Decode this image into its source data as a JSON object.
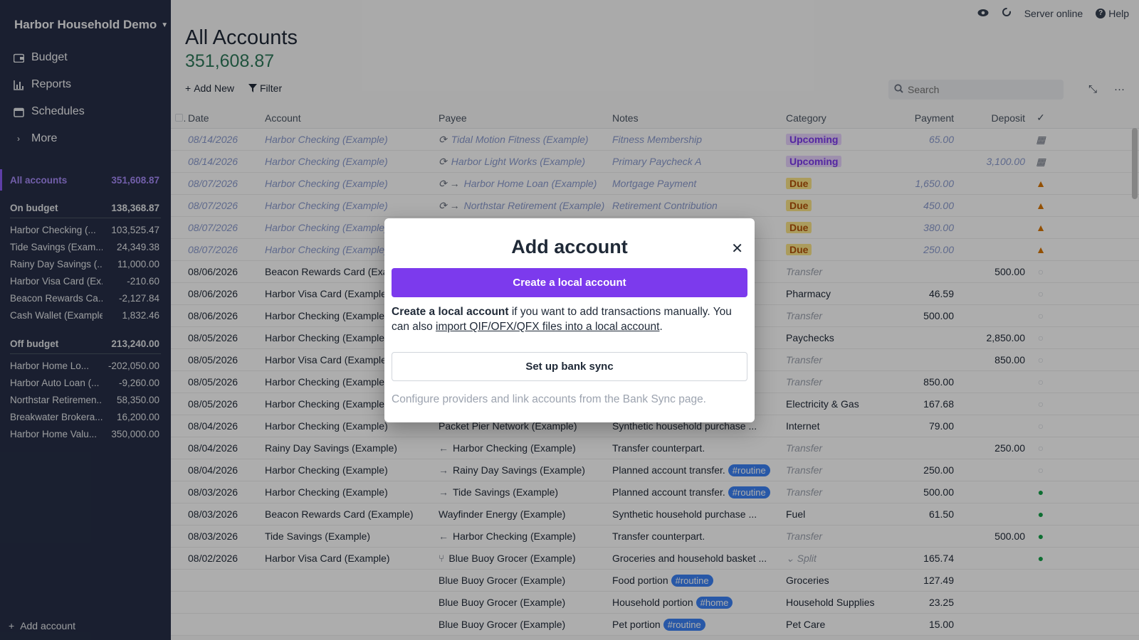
{
  "sidebar": {
    "budget_name": "Harbor Household Demo",
    "nav": [
      {
        "label": "Budget",
        "icon": "wallet-icon"
      },
      {
        "label": "Reports",
        "icon": "chart-icon"
      },
      {
        "label": "Schedules",
        "icon": "calendar-icon"
      },
      {
        "label": "More",
        "icon": "chevron-right-icon"
      }
    ],
    "all_accounts": {
      "label": "All accounts",
      "value": "351,608.87"
    },
    "on_budget": {
      "label": "On budget",
      "value": "138,368.87"
    },
    "on_budget_accounts": [
      {
        "name": "Harbor Checking (...",
        "value": "103,525.47"
      },
      {
        "name": "Tide Savings (Exam...",
        "value": "24,349.38"
      },
      {
        "name": "Rainy Day Savings (...",
        "value": "11,000.00"
      },
      {
        "name": "Harbor Visa Card (Ex...",
        "value": "-210.60"
      },
      {
        "name": "Beacon Rewards Ca...",
        "value": "-2,127.84"
      },
      {
        "name": "Cash Wallet (Example)",
        "value": "1,832.46"
      }
    ],
    "off_budget": {
      "label": "Off budget",
      "value": "213,240.00"
    },
    "off_budget_accounts": [
      {
        "name": "Harbor Home Lo...",
        "value": "-202,050.00"
      },
      {
        "name": "Harbor Auto Loan (...",
        "value": "-9,260.00"
      },
      {
        "name": "Northstar Retiremen...",
        "value": "58,350.00"
      },
      {
        "name": "Breakwater Brokera...",
        "value": "16,200.00"
      },
      {
        "name": "Harbor Home Valu...",
        "value": "350,000.00"
      }
    ],
    "add_account": "Add account"
  },
  "topbar": {
    "server_status": "Server online",
    "help": "Help"
  },
  "main": {
    "title": "All Accounts",
    "balance": "351,608.87",
    "add_new": "Add New",
    "filter": "Filter",
    "search_placeholder": "Search"
  },
  "table": {
    "headers": {
      "date": "Date",
      "account": "Account",
      "payee": "Payee",
      "notes": "Notes",
      "category": "Category",
      "payment": "Payment",
      "deposit": "Deposit"
    },
    "rows": [
      {
        "date": "08/14/2026",
        "account": "Harbor Checking (Example)",
        "payee": "Tidal Motion Fitness (Example)",
        "payee_prefix": "⟳",
        "notes": "Fitness Membership",
        "tag": "",
        "category": "Upcoming",
        "cat_style": "upcoming",
        "payment": "65.00",
        "deposit": "",
        "status": "calendar",
        "future": true
      },
      {
        "date": "08/14/2026",
        "account": "Harbor Checking (Example)",
        "payee": "Harbor Light Works (Example)",
        "payee_prefix": "⟳",
        "notes": "Primary Paycheck A",
        "tag": "",
        "category": "Upcoming",
        "cat_style": "upcoming",
        "payment": "",
        "deposit": "3,100.00",
        "status": "calendar",
        "future": true
      },
      {
        "date": "08/07/2026",
        "account": "Harbor Checking (Example)",
        "payee": "Harbor Home Loan (Example)",
        "payee_prefix": "⟳ →",
        "notes": "Mortgage Payment",
        "tag": "",
        "category": "Due",
        "cat_style": "due",
        "payment": "1,650.00",
        "deposit": "",
        "status": "warning",
        "future": true
      },
      {
        "date": "08/07/2026",
        "account": "Harbor Checking (Example)",
        "payee": "Northstar Retirement (Example)",
        "payee_prefix": "⟳ →",
        "notes": "Retirement Contribution",
        "tag": "",
        "category": "Due",
        "cat_style": "due",
        "payment": "450.00",
        "deposit": "",
        "status": "warning",
        "future": true
      },
      {
        "date": "08/07/2026",
        "account": "Harbor Checking (Example)",
        "payee": "",
        "payee_prefix": "",
        "notes": "",
        "tag": "",
        "category": "Due",
        "cat_style": "due",
        "payment": "380.00",
        "deposit": "",
        "status": "warning",
        "future": true
      },
      {
        "date": "08/07/2026",
        "account": "Harbor Checking (Example)",
        "payee": "",
        "payee_prefix": "",
        "notes": "",
        "tag": "",
        "category": "Due",
        "cat_style": "due",
        "payment": "250.00",
        "deposit": "",
        "status": "warning",
        "future": true
      },
      {
        "date": "08/06/2026",
        "account": "Beacon Rewards Card (Example)",
        "payee": "",
        "payee_prefix": "",
        "notes": "",
        "tag": "",
        "category": "Transfer",
        "cat_style": "transfer",
        "payment": "",
        "deposit": "500.00",
        "status": "empty",
        "future": false
      },
      {
        "date": "08/06/2026",
        "account": "Harbor Visa Card (Example)",
        "payee": "",
        "payee_prefix": "",
        "notes": "",
        "tag": "",
        "category": "Pharmacy",
        "cat_style": "",
        "payment": "46.59",
        "deposit": "",
        "status": "empty",
        "future": false
      },
      {
        "date": "08/06/2026",
        "account": "Harbor Checking (Example)",
        "payee": "",
        "payee_prefix": "",
        "notes": "",
        "tag": "",
        "category": "Transfer",
        "cat_style": "transfer",
        "payment": "500.00",
        "deposit": "",
        "status": "empty",
        "future": false
      },
      {
        "date": "08/05/2026",
        "account": "Harbor Checking (Example)",
        "payee": "",
        "payee_prefix": "",
        "notes": "",
        "tag": "",
        "category": "Paychecks",
        "cat_style": "",
        "payment": "",
        "deposit": "2,850.00",
        "status": "empty",
        "future": false
      },
      {
        "date": "08/05/2026",
        "account": "Harbor Visa Card (Example)",
        "payee": "",
        "payee_prefix": "",
        "notes": "",
        "tag": "",
        "category": "Transfer",
        "cat_style": "transfer",
        "payment": "",
        "deposit": "850.00",
        "status": "empty",
        "future": false
      },
      {
        "date": "08/05/2026",
        "account": "Harbor Checking (Example)",
        "payee": "",
        "payee_prefix": "",
        "notes": "",
        "tag": "",
        "category": "Transfer",
        "cat_style": "transfer",
        "payment": "850.00",
        "deposit": "",
        "status": "empty",
        "future": false
      },
      {
        "date": "08/05/2026",
        "account": "Harbor Checking (Example)",
        "payee": "",
        "payee_prefix": "",
        "notes": "",
        "tag": "",
        "category": "Electricity & Gas",
        "cat_style": "",
        "payment": "167.68",
        "deposit": "",
        "status": "empty",
        "future": false
      },
      {
        "date": "08/04/2026",
        "account": "Harbor Checking (Example)",
        "payee": "Packet Pier Network (Example)",
        "payee_prefix": "",
        "notes": "Synthetic household purchase ...",
        "tag": "",
        "category": "Internet",
        "cat_style": "",
        "payment": "79.00",
        "deposit": "",
        "status": "empty",
        "future": false
      },
      {
        "date": "08/04/2026",
        "account": "Rainy Day Savings (Example)",
        "payee": "Harbor Checking (Example)",
        "payee_prefix": "←",
        "notes": "Transfer counterpart.",
        "tag": "",
        "category": "Transfer",
        "cat_style": "transfer",
        "payment": "",
        "deposit": "250.00",
        "status": "empty",
        "future": false
      },
      {
        "date": "08/04/2026",
        "account": "Harbor Checking (Example)",
        "payee": "Rainy Day Savings (Example)",
        "payee_prefix": "→",
        "notes": "Planned account transfer.",
        "tag": "#routine",
        "category": "Transfer",
        "cat_style": "transfer",
        "payment": "250.00",
        "deposit": "",
        "status": "empty",
        "future": false
      },
      {
        "date": "08/03/2026",
        "account": "Harbor Checking (Example)",
        "payee": "Tide Savings (Example)",
        "payee_prefix": "→",
        "notes": "Planned account transfer.",
        "tag": "#routine",
        "category": "Transfer",
        "cat_style": "transfer",
        "payment": "500.00",
        "deposit": "",
        "status": "ok",
        "future": false
      },
      {
        "date": "08/03/2026",
        "account": "Beacon Rewards Card (Example)",
        "payee": "Wayfinder Energy (Example)",
        "payee_prefix": "",
        "notes": "Synthetic household purchase ...",
        "tag": "",
        "category": "Fuel",
        "cat_style": "",
        "payment": "61.50",
        "deposit": "",
        "status": "ok",
        "future": false
      },
      {
        "date": "08/03/2026",
        "account": "Tide Savings (Example)",
        "payee": "Harbor Checking (Example)",
        "payee_prefix": "←",
        "notes": "Transfer counterpart.",
        "tag": "",
        "category": "Transfer",
        "cat_style": "transfer",
        "payment": "",
        "deposit": "500.00",
        "status": "ok",
        "future": false
      },
      {
        "date": "08/02/2026",
        "account": "Harbor Visa Card (Example)",
        "payee": "Blue Buoy Grocer (Example)",
        "payee_prefix": "⑂",
        "notes": "Groceries and household basket ...",
        "tag": "",
        "category": "⌄ Split",
        "cat_style": "transfer",
        "payment": "165.74",
        "deposit": "",
        "status": "ok",
        "future": false,
        "split_parent": true
      },
      {
        "date": "",
        "account": "",
        "payee": "Blue Buoy Grocer (Example)",
        "payee_prefix": "",
        "notes": "Food portion",
        "tag": "#routine",
        "category": "Groceries",
        "cat_style": "",
        "payment": "127.49",
        "deposit": "",
        "status": "",
        "future": false,
        "split_child": true
      },
      {
        "date": "",
        "account": "",
        "payee": "Blue Buoy Grocer (Example)",
        "payee_prefix": "",
        "notes": "Household portion",
        "tag": "#home",
        "category": "Household Supplies",
        "cat_style": "",
        "payment": "23.25",
        "deposit": "",
        "status": "",
        "future": false,
        "split_child": true
      },
      {
        "date": "",
        "account": "",
        "payee": "Blue Buoy Grocer (Example)",
        "payee_prefix": "",
        "notes": "Pet portion",
        "tag": "#routine",
        "category": "Pet Care",
        "cat_style": "",
        "payment": "15.00",
        "deposit": "",
        "status": "",
        "future": false,
        "split_child": true
      }
    ]
  },
  "modal": {
    "title": "Add account",
    "primary_button": "Create a local account",
    "desc_bold": "Create a local account",
    "desc_mid": " if you want to add transactions manually. You can also ",
    "desc_link": "import QIF/OFX/QFX files into a local account",
    "desc_end": ".",
    "secondary_button": "Set up bank sync",
    "hint": "Configure providers and link accounts from the Bank Sync page."
  },
  "colors": {
    "sidebar_bg": "#272f47",
    "accent": "#7c3aed",
    "balance_green": "#2f7a5a"
  }
}
